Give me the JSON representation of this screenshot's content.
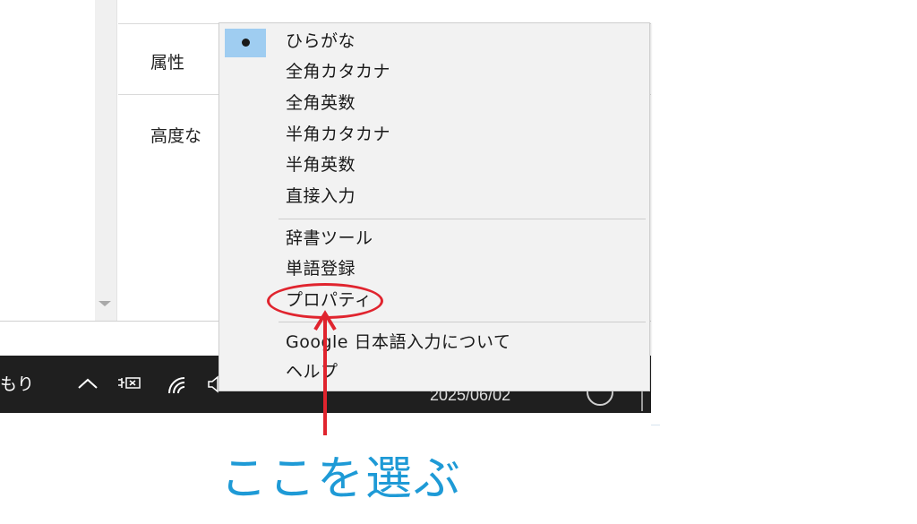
{
  "background_window": {
    "attributes_label": "属性",
    "advanced_label": "高度な"
  },
  "taskbar": {
    "left_text": "もり",
    "chevron_icon": "chevron-up-icon",
    "date": "2025/06/02"
  },
  "ime_menu": {
    "selected_index": 0,
    "input_modes": [
      "ひらがな",
      "全角カタカナ",
      "全角英数",
      "半角カタカナ",
      "半角英数",
      "直接入力"
    ],
    "tools": [
      "辞書ツール",
      "単語登録",
      "プロパティ"
    ],
    "info": [
      "Google 日本語入力について",
      "ヘルプ"
    ]
  },
  "annotation": {
    "caption": "ここを選ぶ",
    "highlight_color": "#e0242e",
    "caption_color": "#1e9ad6"
  },
  "colors": {
    "menu_background": "#f2f2f2",
    "selected_highlight": "#9fcdf1",
    "taskbar": "#1f1f1f"
  }
}
